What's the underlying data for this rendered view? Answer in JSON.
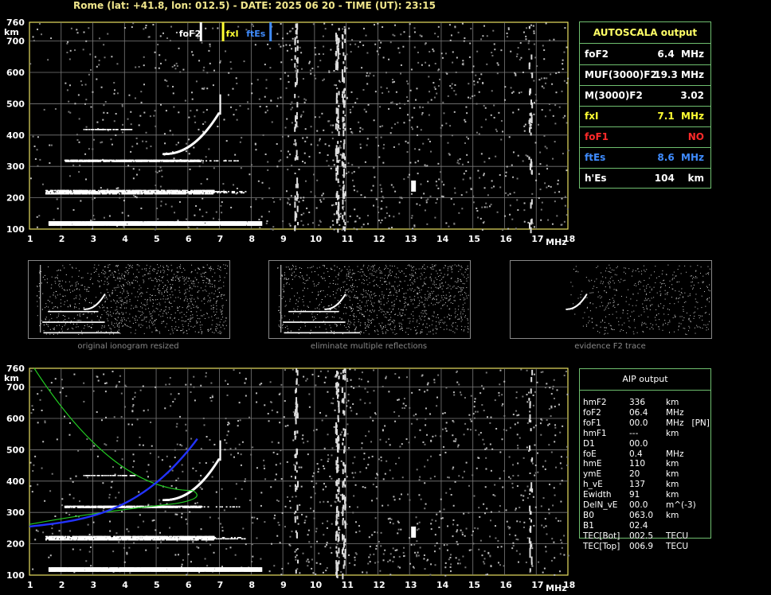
{
  "header": {
    "title": "Rome (lat: +41.8, lon: 012.5) - DATE: 2025 06 20 - TIME (UT): 23:15"
  },
  "axis": {
    "y_unit": "km",
    "x_unit": "MHz",
    "y_ticks": [
      "760",
      "700",
      "600",
      "500",
      "400",
      "300",
      "200",
      "100"
    ],
    "x_ticks": [
      "1",
      "2",
      "3",
      "4",
      "5",
      "6",
      "7",
      "8",
      "9",
      "10",
      "11",
      "12",
      "13",
      "14",
      "15",
      "16",
      "17",
      "18"
    ]
  },
  "markers": {
    "foF2": "foF2",
    "fxI": "fxI",
    "ftEs": "ftEs"
  },
  "autoscala": {
    "title": "AUTOSCALA output",
    "rows": [
      {
        "key": "foF2",
        "value": "6.4  MHz",
        "color": "#ffffff"
      },
      {
        "key": "MUF(3000)F2",
        "value": "19.3 MHz",
        "color": "#ffffff"
      },
      {
        "key": "M(3000)F2",
        "value": "3.02",
        "color": "#ffffff"
      },
      {
        "key": "fxI",
        "value": "7.1  MHz",
        "color": "#ffff33"
      },
      {
        "key": "foF1",
        "value": "NO",
        "color": "#ff2a2a"
      },
      {
        "key": "ftEs",
        "value": "8.6  MHz",
        "color": "#3f8cff"
      },
      {
        "key": "h'Es",
        "value": "104    km",
        "color": "#ffffff"
      }
    ]
  },
  "thumbs": [
    {
      "caption": "original ionogram resized"
    },
    {
      "caption": "eliminate multiple reflections"
    },
    {
      "caption": "evidence F2 trace"
    }
  ],
  "aip": {
    "title": "AIP output",
    "rows": [
      {
        "k": "hmF2",
        "v": "336",
        "u": "km"
      },
      {
        "k": "foF2",
        "v": "06.4",
        "u": "MHz"
      },
      {
        "k": "foF1",
        "v": "00.0",
        "u": "MHz   [PN]"
      },
      {
        "k": "hmF1",
        "v": "---",
        "u": "km"
      },
      {
        "k": "D1",
        "v": "00.0",
        "u": ""
      },
      {
        "k": "foE",
        "v": "0.4",
        "u": "MHz"
      },
      {
        "k": "hmE",
        "v": "110",
        "u": "km"
      },
      {
        "k": "ymE",
        "v": "20",
        "u": "km"
      },
      {
        "k": "h_vE",
        "v": "137",
        "u": "km"
      },
      {
        "k": "Ewidth",
        "v": "91",
        "u": "km"
      },
      {
        "k": "DelN_vE",
        "v": "00.0",
        "u": "m^(-3)"
      },
      {
        "k": "B0",
        "v": "063.0",
        "u": "km"
      },
      {
        "k": "B1",
        "v": "02.4",
        "u": ""
      },
      {
        "k": "TEC[Bot]",
        "v": "002.5",
        "u": "TECU"
      },
      {
        "k": "TEC[Top]",
        "v": "006.9",
        "u": "TECU"
      }
    ]
  },
  "colors": {
    "grid": "#7a7a7a",
    "frame": "#e8e060",
    "green": "#22cc22",
    "blue": "#2233ff",
    "marker_white": "#ffffff",
    "marker_yellow": "#ffff33",
    "marker_blue": "#3f8cff"
  }
}
